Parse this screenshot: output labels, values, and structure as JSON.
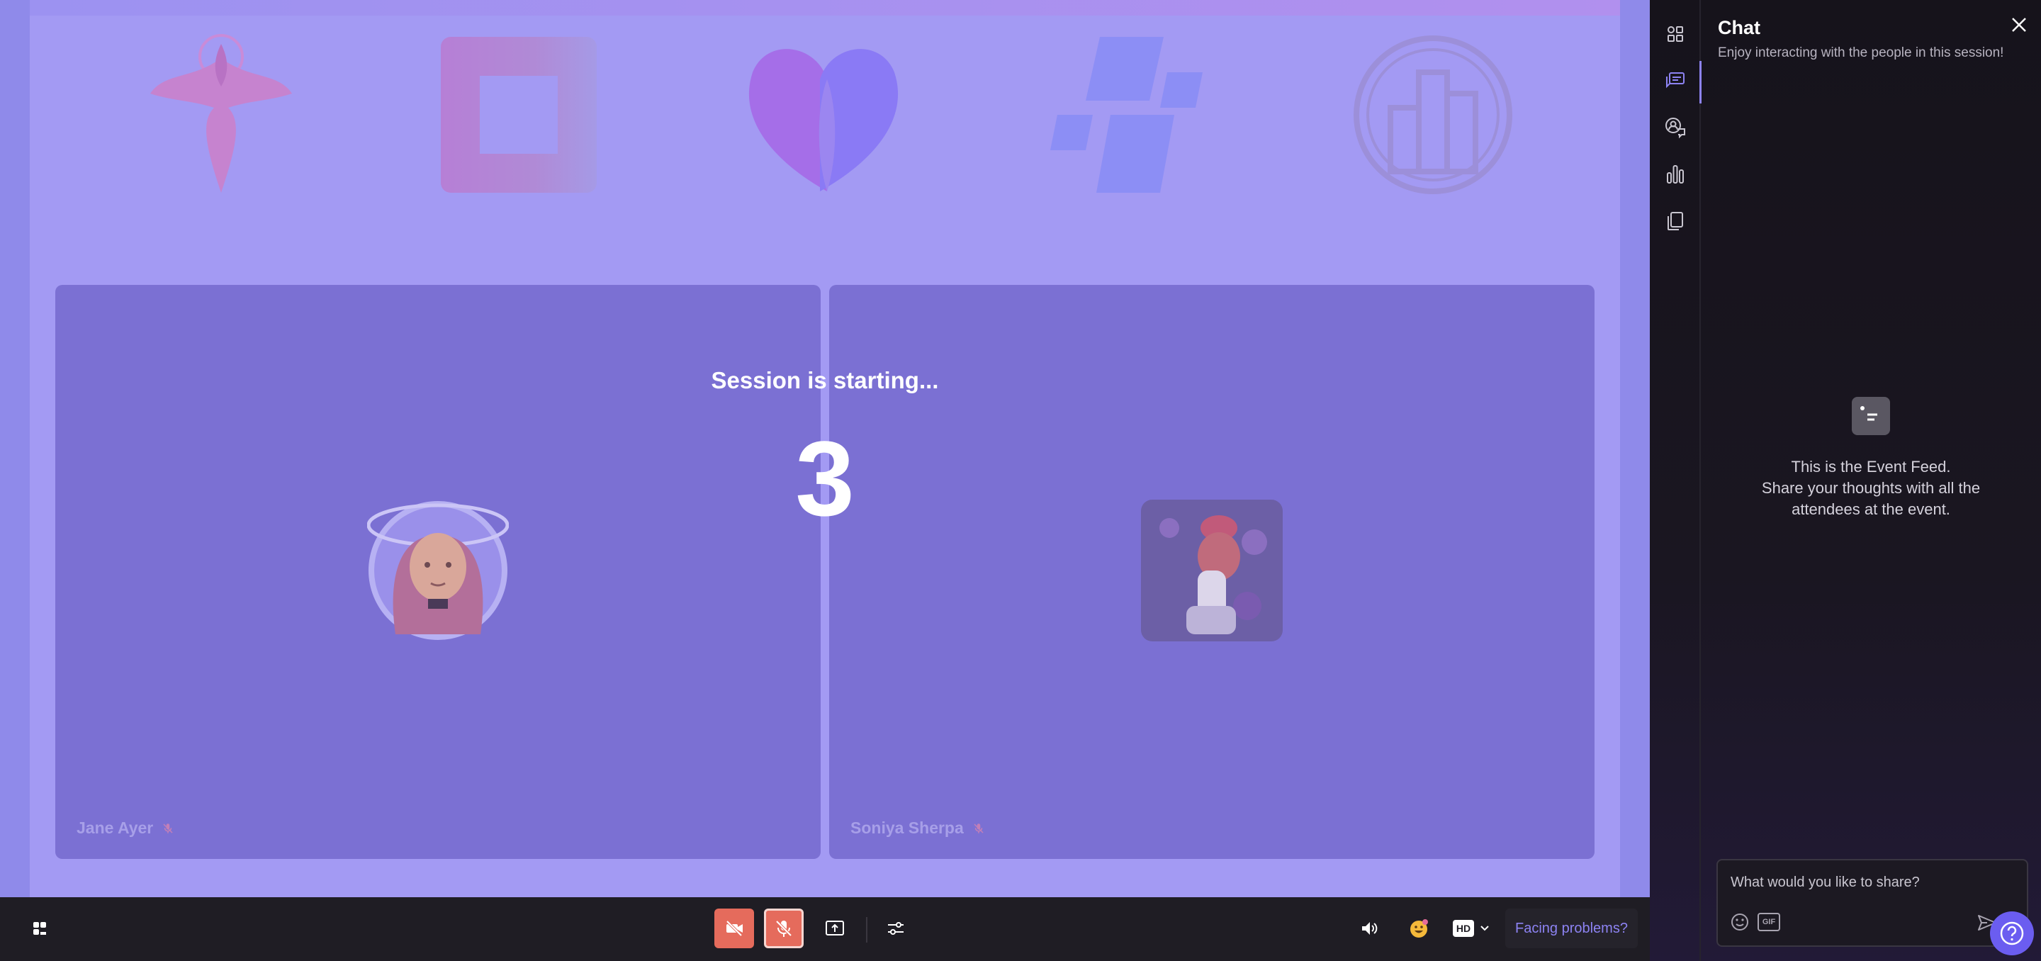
{
  "session": {
    "countdown_title": "Session is starting...",
    "countdown_value": "3"
  },
  "logos": [
    "phoenix-logo",
    "square-frame-logo",
    "heart-logo",
    "tiles-logo",
    "building-logo"
  ],
  "participants": [
    {
      "name": "Jane Ayer",
      "mic": "muted"
    },
    {
      "name": "Soniya Sherpa",
      "mic": "muted"
    }
  ],
  "toolbar": {
    "camera_state": "off",
    "mic_state": "off",
    "quality_label": "HD",
    "facing_problems_label": "Facing problems?"
  },
  "chat": {
    "title": "Chat",
    "subtitle": "Enjoy interacting with the people in this session!",
    "empty_line1": "This is the Event Feed.",
    "empty_line2": "Share your thoughts with all the",
    "empty_line3": "attendees at the event.",
    "input_placeholder": "What would you like to share?",
    "gif_label": "GIF"
  },
  "colors": {
    "accent": "#8d83f3",
    "danger": "#e56b5c",
    "stage": "#a39af3",
    "tile": "#7b70d3"
  }
}
